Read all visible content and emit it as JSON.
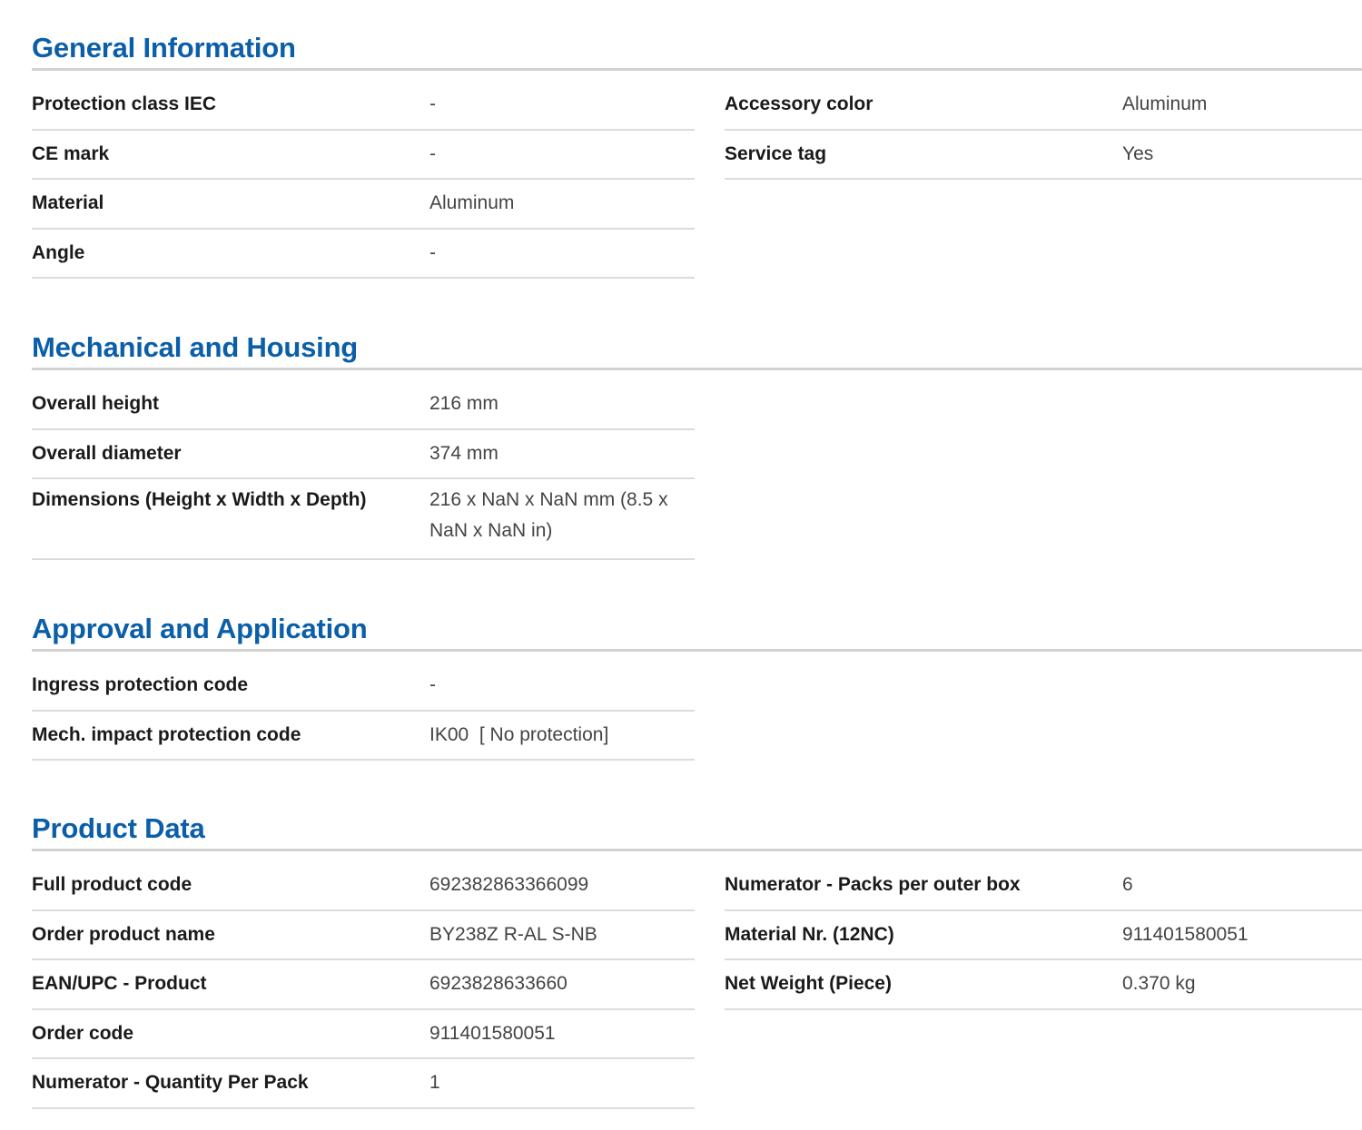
{
  "sections": {
    "general": {
      "title": "General Information",
      "left": [
        {
          "label": "Protection class IEC",
          "value": "-"
        },
        {
          "label": "CE mark",
          "value": "-"
        },
        {
          "label": "Material",
          "value": "Aluminum"
        },
        {
          "label": "Angle",
          "value": "-"
        }
      ],
      "right": [
        {
          "label": "Accessory color",
          "value": "Aluminum"
        },
        {
          "label": "Service tag",
          "value": "Yes"
        }
      ]
    },
    "mechanical": {
      "title": "Mechanical and Housing",
      "left": [
        {
          "label": "Overall height",
          "value": "216 mm"
        },
        {
          "label": "Overall diameter",
          "value": "374 mm"
        },
        {
          "label": "Dimensions (Height x Width x Depth)",
          "value": "216 x NaN x NaN mm (8.5 x NaN x NaN in)"
        }
      ]
    },
    "approval": {
      "title": "Approval and Application",
      "left": [
        {
          "label": "Ingress protection code",
          "value": "-"
        },
        {
          "label": "Mech. impact protection code",
          "value": "IK00  [ No protection]"
        }
      ]
    },
    "product": {
      "title": "Product Data",
      "left": [
        {
          "label": "Full product code",
          "value": "692382863366099"
        },
        {
          "label": "Order product name",
          "value": "BY238Z R-AL S-NB"
        },
        {
          "label": "EAN/UPC - Product",
          "value": "6923828633660"
        },
        {
          "label": "Order code",
          "value": "911401580051"
        },
        {
          "label": "Numerator - Quantity Per Pack",
          "value": "1"
        }
      ],
      "right": [
        {
          "label": "Numerator - Packs per outer box",
          "value": "6"
        },
        {
          "label": "Material Nr. (12NC)",
          "value": "911401580051"
        },
        {
          "label": "Net Weight (Piece)",
          "value": "0.370 kg"
        }
      ]
    }
  },
  "colors": {
    "heading": "#0b5ea8",
    "rule": "#dcdcdc"
  }
}
